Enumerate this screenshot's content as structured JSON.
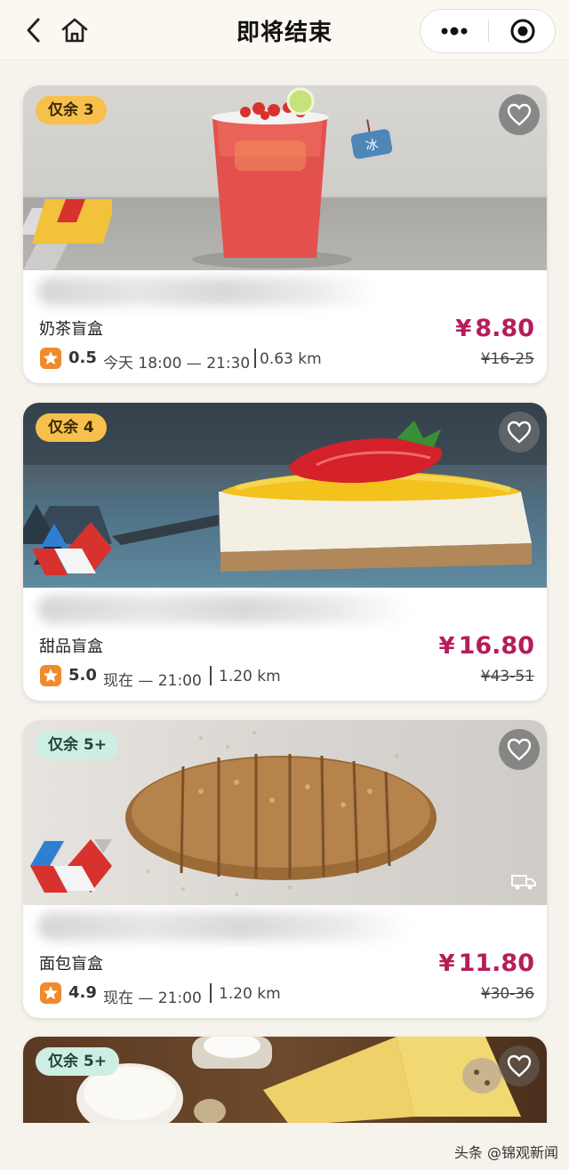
{
  "nav": {
    "title": "即将结束",
    "icons": [
      "chevron-left-icon",
      "home-icon",
      "more-dots-icon",
      "target-close-icon"
    ]
  },
  "cards": [
    {
      "stock": "仅余 3",
      "name": "奶茶盲盒",
      "rating": "0.5",
      "time": "今天 18:00 — 21:30",
      "distance": "0.63 km",
      "price": "8.80",
      "currency": "¥",
      "original_price": "¥16-25",
      "image": "iced-fruit-tea",
      "stock_style": "low"
    },
    {
      "stock": "仅余 4",
      "name": "甜品盲盒",
      "rating": "5.0",
      "time": "现在 — 21:00",
      "distance": "1.20 km",
      "price": "16.80",
      "currency": "¥",
      "original_price": "¥43-51",
      "image": "cheesecake",
      "stock_style": "low"
    },
    {
      "stock": "仅余 5+",
      "name": "面包盲盒",
      "rating": "4.9",
      "time": "现在 — 21:00",
      "distance": "1.20 km",
      "price": "11.80",
      "currency": "¥",
      "original_price": "¥30-36",
      "image": "sliced-bread",
      "stock_style": "many"
    },
    {
      "stock": "仅余 5+",
      "image": "cheese-board",
      "stock_style": "many"
    }
  ],
  "watermark": "头条 @锦观新闻",
  "colors": {
    "price": "#b51d5a",
    "badge_low": "#f7c04c",
    "badge_many": "#cdeee3",
    "rating_star": "#f08a2c",
    "page_bg": "#f6f3ec"
  }
}
